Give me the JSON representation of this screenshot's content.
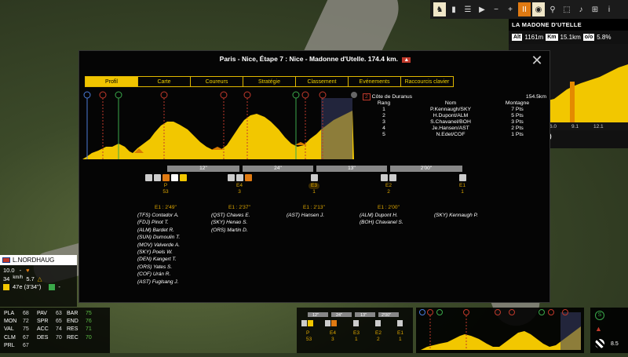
{
  "toolbar": {
    "pause": "II",
    "info": "i"
  },
  "climb_panel": {
    "title": "LA MADONE D'UTELLE",
    "alt_label": "Alt",
    "alt_value": "1161m",
    "km_label": "Km",
    "km_value": "15.1km",
    "pct_label": "o/o",
    "pct_value": "5.8%",
    "ticks": [
      "6.0",
      "9.1",
      "12.1"
    ],
    "footer": "TELLE (8.5 km)"
  },
  "modal": {
    "title": "Paris - Nice, Étape 7 : Nice - Madonne d'Utelle. 174.4 km.",
    "close": "✕",
    "tabs": [
      "Profil",
      "Carte",
      "Coureurs",
      "Stratégie",
      "Classement",
      "Evénements",
      "Raccourcis clavier"
    ],
    "active_tab": 0
  },
  "side_table": {
    "badge": "2",
    "climb": "Côte de Duranus",
    "distance": "154.5km",
    "columns": [
      "Rang",
      "Nom",
      "Montagne"
    ],
    "rows": [
      [
        "1",
        "P.Kennaugh/SKY",
        "7 Pts"
      ],
      [
        "2",
        "H.Dupont/ALM",
        "5 Pts"
      ],
      [
        "3",
        "S.Chavanel/BOH",
        "3 Pts"
      ],
      [
        "4",
        "Je.Hansen/AST",
        "2 Pts"
      ],
      [
        "5",
        "N.Edet/COF",
        "1 Pts"
      ]
    ]
  },
  "gaps": [
    "12''",
    "24''",
    "13''",
    "2'00''"
  ],
  "groups": [
    {
      "code": "P",
      "count": "53",
      "time": "E1 : 2'49''",
      "riders": [
        "(TFS) Contador A.",
        "(FDJ) Pinot T.",
        "(ALM) Bardet R.",
        "(SUN) Dumoulin T.",
        "(MOV) Valverde A.",
        "(SKY) Poels W.",
        "(DEN) Kangert T.",
        "(ORS) Yates S.",
        "(COF) Urán R.",
        "(AST) Fuglsang J."
      ]
    },
    {
      "code": "E4",
      "count": "3",
      "time": "E1 : 2'37''",
      "riders": [
        "(QST) Chaves E.",
        "(SKY) Henao S.",
        "(ORS) Martin D."
      ]
    },
    {
      "code": "E3",
      "count": "1",
      "time": "E1 : 2'13''",
      "riders": [
        "(AST) Hansen J."
      ]
    },
    {
      "code": "E2",
      "count": "2",
      "time": "E1 : 2'00''",
      "riders": [
        "(ALM) Dupont H.",
        "(BOH) Chavanel S."
      ]
    },
    {
      "code": "E1",
      "count": "1",
      "time": "",
      "riders": [
        "(SKY) Kennaugh P."
      ]
    }
  ],
  "rider_panel": {
    "name": "L.NORDHAUG",
    "speed": "10.0",
    "km": "34",
    "unit": "km/h",
    "power": "5.7",
    "rank": "47e (3'34'')",
    "dash1": "-",
    "dash2": "-"
  },
  "stats": [
    [
      "PLA",
      "68",
      "PAV",
      "63",
      "BAR",
      "75"
    ],
    [
      "MON",
      "72",
      "SPR",
      "65",
      "END",
      "76"
    ],
    [
      "VAL",
      "75",
      "ACC",
      "74",
      "RES",
      "71"
    ],
    [
      "CLM",
      "67",
      "DES",
      "70",
      "REC",
      "70"
    ],
    [
      "PRL",
      "67",
      "",
      "",
      "",
      ""
    ]
  ],
  "mini_bottom": {
    "gaps": [
      "12''",
      "24''",
      "13''",
      "2'00''"
    ],
    "codes": [
      "P",
      "E4",
      "E3",
      "E2",
      "E1"
    ],
    "counts": [
      "53",
      "3",
      "1",
      "2",
      "1"
    ]
  },
  "right_panel": {
    "value": "8.5"
  },
  "colors": {
    "accent": "#f0c400",
    "tab_border": "#e0b800",
    "profile": "#f2c700",
    "gap_bar": "#888888"
  }
}
